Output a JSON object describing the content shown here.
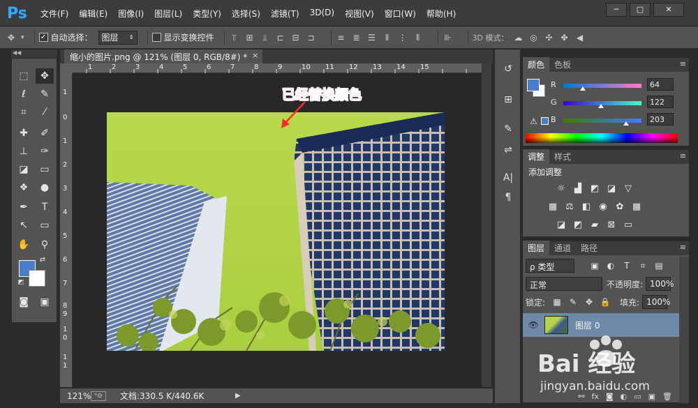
{
  "app": {
    "logo": "Ps",
    "menu": [
      "文件(F)",
      "编辑(E)",
      "图像(I)",
      "图层(L)",
      "类型(Y)",
      "选择(S)",
      "滤镜(T)",
      "3D(D)",
      "视图(V)",
      "窗口(W)",
      "帮助(H)"
    ],
    "window_controls": [
      "─",
      "▢",
      "✕"
    ]
  },
  "options_bar": {
    "auto_select_label": "自动选择：",
    "auto_select_checked": true,
    "auto_select_target": "图层",
    "show_transform_label": "显示变换控件",
    "show_transform_checked": false,
    "mode_3d_label": "3D 模式："
  },
  "document": {
    "tab_title": "缩小的图片.png @ 121% (图层 0, RGB/8#) *",
    "tab_close": "×",
    "ruler_h_labels": [
      "1",
      "2",
      "3",
      "4",
      "5",
      "6",
      "7",
      "8",
      "9",
      "10",
      "11",
      "12",
      "13",
      "14",
      "15"
    ],
    "ruler_v_labels": [
      "1",
      "0",
      "1",
      "2",
      "3",
      "4",
      "5",
      "6",
      "7",
      "8",
      "9",
      "1",
      "0",
      "1",
      "1"
    ],
    "annotation": "已经替换颜色",
    "sky_color": "#b5d64a"
  },
  "status_bar": {
    "zoom": "121%",
    "doc_info": "文档:330.5 K/440.6K",
    "arrow": "▶"
  },
  "color_panel": {
    "tabs": [
      "颜色",
      "色板"
    ],
    "active_tab": 0,
    "foreground": "#4a7cc9",
    "background": "#ffffff",
    "channels": [
      {
        "label": "R",
        "value": "64",
        "fraction": 0.25
      },
      {
        "label": "G",
        "value": "122",
        "fraction": 0.48
      },
      {
        "label": "B",
        "value": "203",
        "fraction": 0.8
      }
    ]
  },
  "adjustments_panel": {
    "tabs": [
      "调整",
      "样式"
    ],
    "active_tab": 0,
    "title": "添加调整"
  },
  "layers_panel": {
    "tabs": [
      "图层",
      "通道",
      "路径"
    ],
    "active_tab": 0,
    "filter_label": "ρ 类型",
    "blend_mode": "正常",
    "opacity_label": "不透明度:",
    "opacity_value": "100%",
    "lock_label": "锁定:",
    "fill_label": "填充:",
    "fill_value": "100%",
    "layers": [
      {
        "name": "图层 0",
        "visible": true,
        "selected": true
      }
    ]
  },
  "watermark": {
    "brand": "Bai 经验",
    "url": "jingyan.baidu.com"
  }
}
